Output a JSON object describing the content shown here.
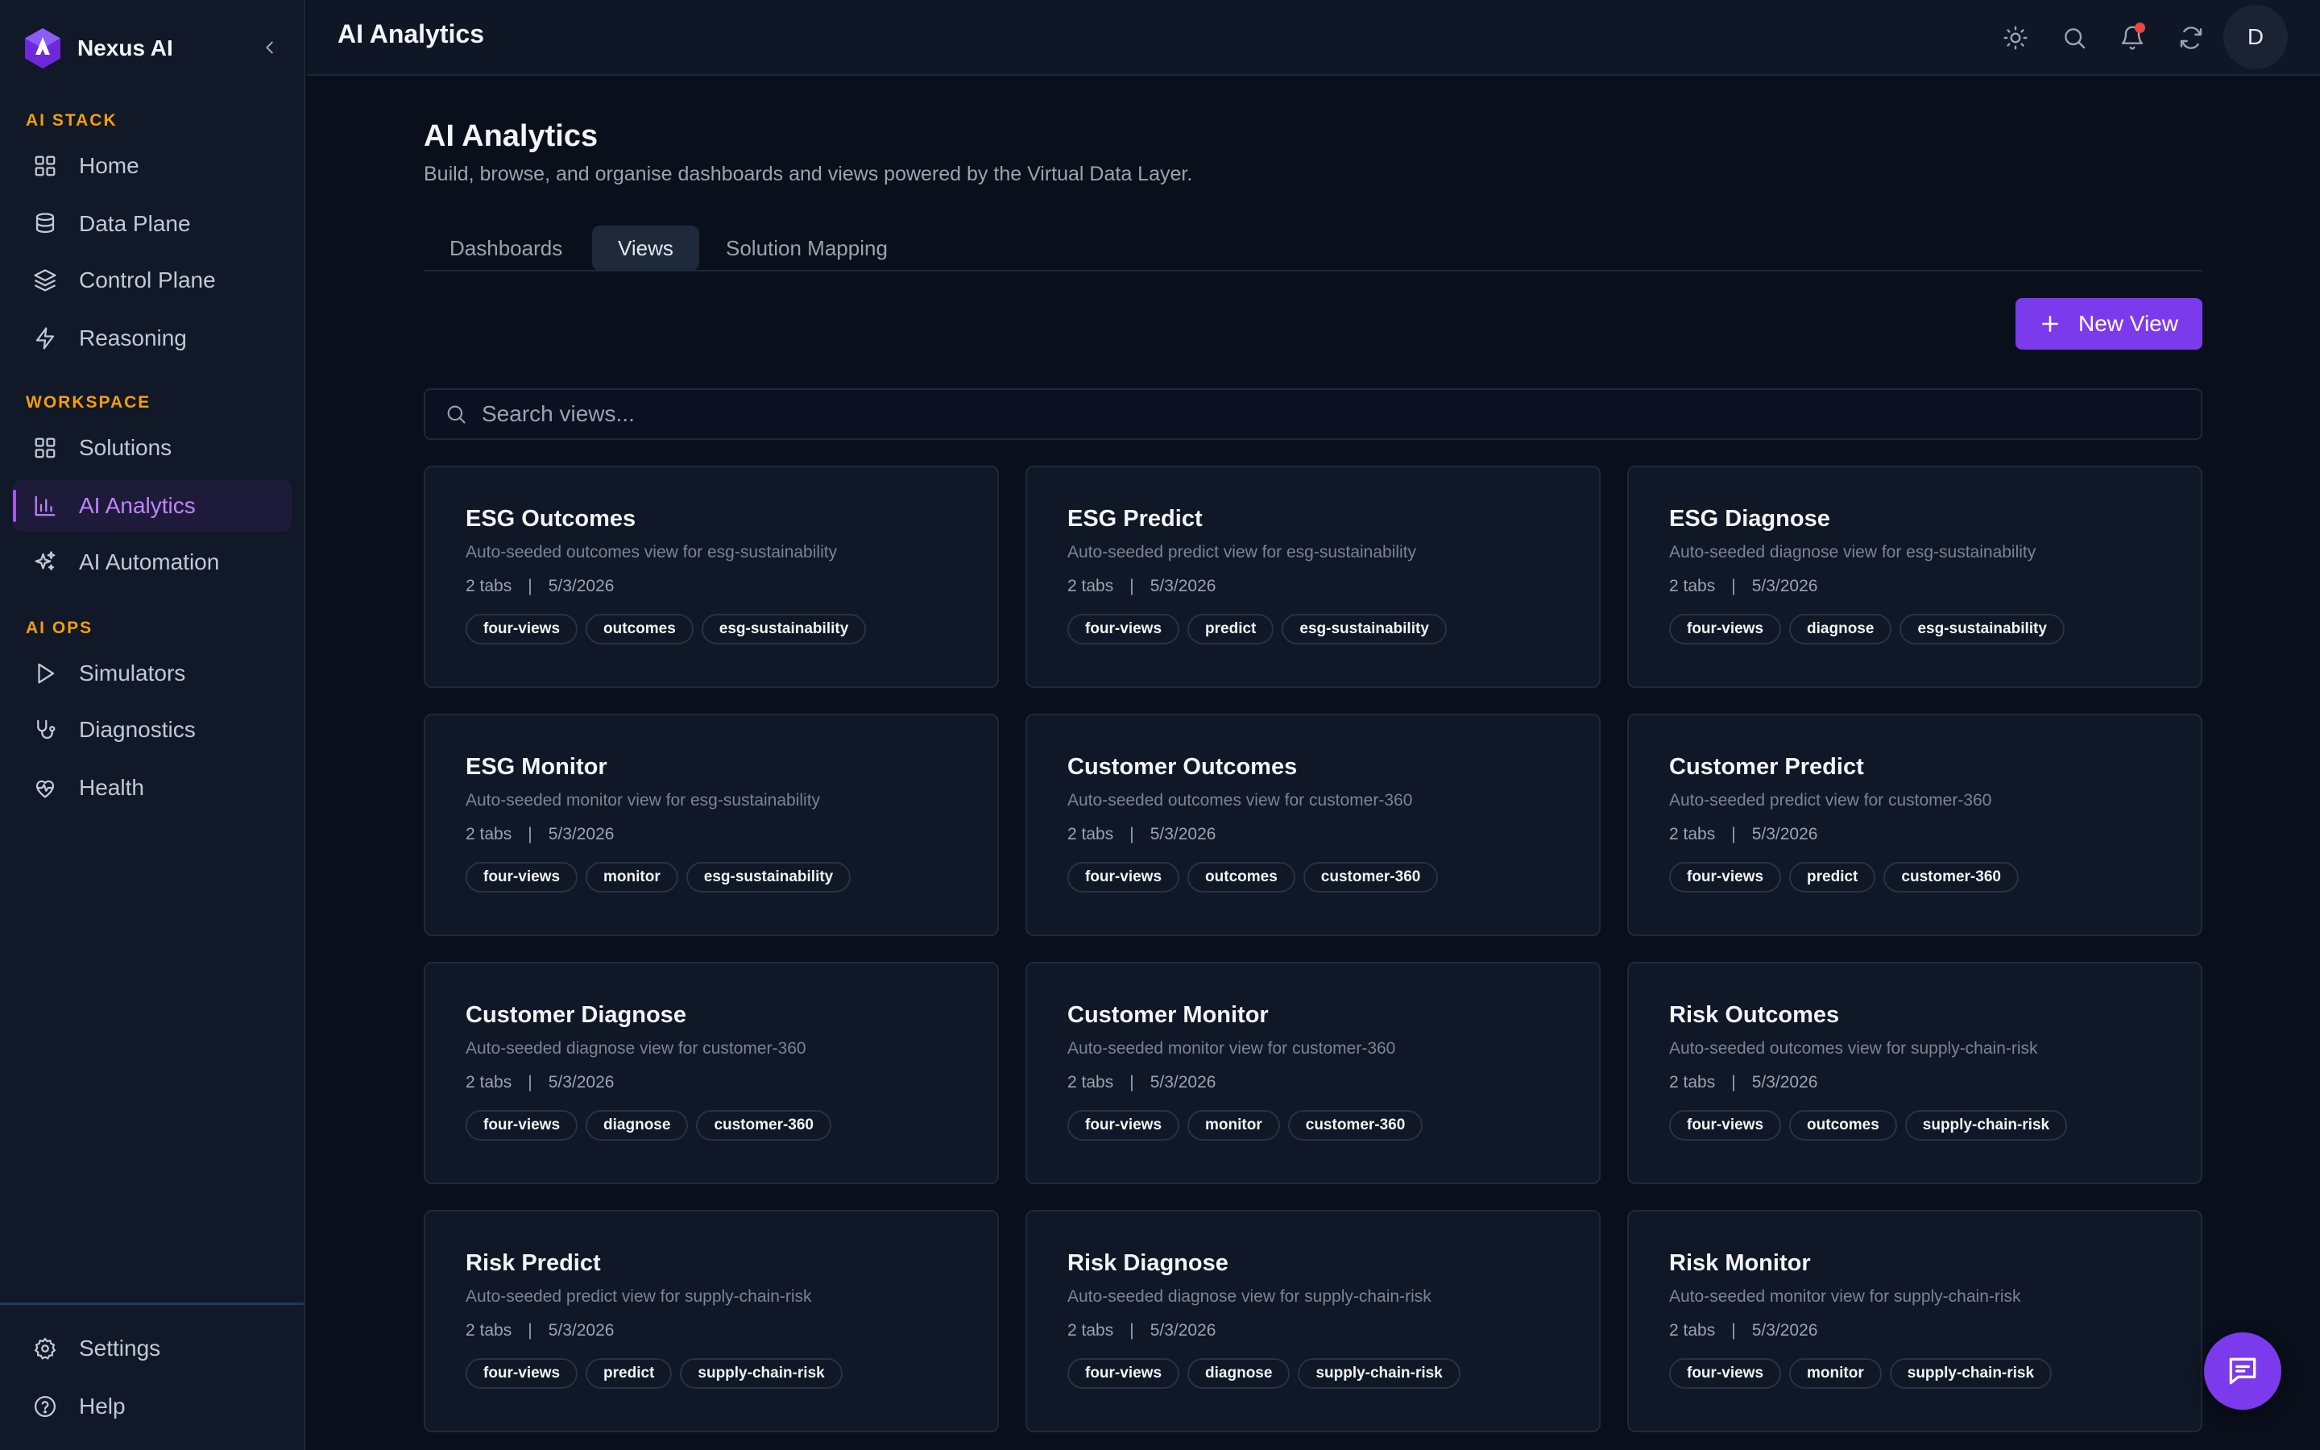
{
  "brand": {
    "name": "Nexus AI"
  },
  "sidebar": {
    "sections": [
      {
        "label": "AI STACK"
      },
      {
        "label": "WORKSPACE"
      },
      {
        "label": "AI OPS"
      }
    ],
    "items": [
      {
        "label": "Home",
        "icon": "grid-icon"
      },
      {
        "label": "Data Plane",
        "icon": "database-icon"
      },
      {
        "label": "Control Plane",
        "icon": "layers-icon"
      },
      {
        "label": "Reasoning",
        "icon": "bolt-icon"
      },
      {
        "label": "Solutions",
        "icon": "grid-icon"
      },
      {
        "label": "AI Analytics",
        "icon": "bar-chart-icon",
        "active": true
      },
      {
        "label": "AI Automation",
        "icon": "sparkles-icon"
      },
      {
        "label": "Simulators",
        "icon": "play-icon"
      },
      {
        "label": "Diagnostics",
        "icon": "stethoscope-icon"
      },
      {
        "label": "Health",
        "icon": "heart-pulse-icon"
      }
    ],
    "footer": [
      {
        "label": "Settings",
        "icon": "gear-icon"
      },
      {
        "label": "Help",
        "icon": "help-circle-icon"
      }
    ]
  },
  "topbar": {
    "title": "AI Analytics",
    "avatar_initial": "D"
  },
  "main": {
    "title": "AI Analytics",
    "subtitle": "Build, browse, and organise dashboards and views powered by the Virtual Data Layer.",
    "tabs": [
      {
        "label": "Dashboards"
      },
      {
        "label": "Views",
        "active": true
      },
      {
        "label": "Solution Mapping"
      }
    ],
    "new_view_label": "New View",
    "search": {
      "placeholder": "Search views...",
      "value": ""
    },
    "tab_count_suffix": "tabs",
    "cards": [
      {
        "title": "ESG Outcomes",
        "desc": "Auto-seeded outcomes view for esg-sustainability",
        "tabs": "2",
        "date": "5/3/2026",
        "tags": [
          "four-views",
          "outcomes",
          "esg-sustainability"
        ]
      },
      {
        "title": "ESG Predict",
        "desc": "Auto-seeded predict view for esg-sustainability",
        "tabs": "2",
        "date": "5/3/2026",
        "tags": [
          "four-views",
          "predict",
          "esg-sustainability"
        ]
      },
      {
        "title": "ESG Diagnose",
        "desc": "Auto-seeded diagnose view for esg-sustainability",
        "tabs": "2",
        "date": "5/3/2026",
        "tags": [
          "four-views",
          "diagnose",
          "esg-sustainability"
        ]
      },
      {
        "title": "ESG Monitor",
        "desc": "Auto-seeded monitor view for esg-sustainability",
        "tabs": "2",
        "date": "5/3/2026",
        "tags": [
          "four-views",
          "monitor",
          "esg-sustainability"
        ]
      },
      {
        "title": "Customer Outcomes",
        "desc": "Auto-seeded outcomes view for customer-360",
        "tabs": "2",
        "date": "5/3/2026",
        "tags": [
          "four-views",
          "outcomes",
          "customer-360"
        ]
      },
      {
        "title": "Customer Predict",
        "desc": "Auto-seeded predict view for customer-360",
        "tabs": "2",
        "date": "5/3/2026",
        "tags": [
          "four-views",
          "predict",
          "customer-360"
        ]
      },
      {
        "title": "Customer Diagnose",
        "desc": "Auto-seeded diagnose view for customer-360",
        "tabs": "2",
        "date": "5/3/2026",
        "tags": [
          "four-views",
          "diagnose",
          "customer-360"
        ]
      },
      {
        "title": "Customer Monitor",
        "desc": "Auto-seeded monitor view for customer-360",
        "tabs": "2",
        "date": "5/3/2026",
        "tags": [
          "four-views",
          "monitor",
          "customer-360"
        ]
      },
      {
        "title": "Risk Outcomes",
        "desc": "Auto-seeded outcomes view for supply-chain-risk",
        "tabs": "2",
        "date": "5/3/2026",
        "tags": [
          "four-views",
          "outcomes",
          "supply-chain-risk"
        ]
      },
      {
        "title": "Risk Predict",
        "desc": "Auto-seeded predict view for supply-chain-risk",
        "tabs": "2",
        "date": "5/3/2026",
        "tags": [
          "four-views",
          "predict",
          "supply-chain-risk"
        ]
      },
      {
        "title": "Risk Diagnose",
        "desc": "Auto-seeded diagnose view for supply-chain-risk",
        "tabs": "2",
        "date": "5/3/2026",
        "tags": [
          "four-views",
          "diagnose",
          "supply-chain-risk"
        ]
      },
      {
        "title": "Risk Monitor",
        "desc": "Auto-seeded monitor view for supply-chain-risk",
        "tabs": "2",
        "date": "5/3/2026",
        "tags": [
          "four-views",
          "monitor",
          "supply-chain-risk"
        ]
      }
    ]
  },
  "colors": {
    "accent": "#7c3aed",
    "active_nav_text": "#c084fc",
    "section_label": "#f59e0b",
    "notification": "#ef4444"
  }
}
